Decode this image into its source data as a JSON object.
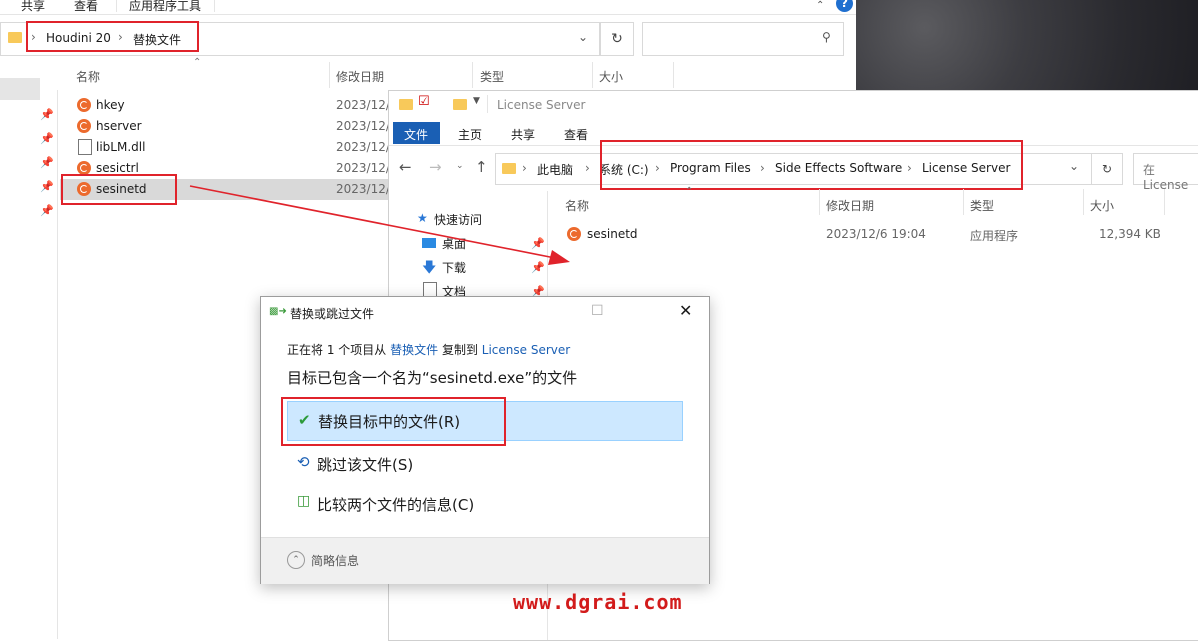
{
  "back_window": {
    "ribbon_tabs": [
      "共享",
      "查看",
      "应用程序工具"
    ],
    "breadcrumb": [
      "Houdini 20",
      "替换文件"
    ],
    "columns": [
      "名称",
      "修改日期",
      "类型",
      "大小"
    ],
    "files": [
      {
        "name": "hkey",
        "date": "2023/12/",
        "icon": "houdini-icon"
      },
      {
        "name": "hserver",
        "date": "2023/12/",
        "icon": "houdini-icon"
      },
      {
        "name": "libLM.dll",
        "date": "2023/12/",
        "icon": "dll-icon"
      },
      {
        "name": "sesictrl",
        "date": "2023/12/",
        "icon": "houdini-icon"
      },
      {
        "name": "sesinetd",
        "date": "2023/12/",
        "icon": "houdini-icon"
      }
    ]
  },
  "front_window": {
    "title": "License Server",
    "ribbon_tabs": [
      "文件",
      "主页",
      "共享",
      "查看"
    ],
    "breadcrumb": [
      "此电脑",
      "系统 (C:)",
      "Program Files",
      "Side Effects Software",
      "License Server"
    ],
    "search_placeholder": "在 License",
    "nav_items": [
      "快速访问",
      "桌面",
      "下载",
      "文档"
    ],
    "columns": [
      "名称",
      "修改日期",
      "类型",
      "大小"
    ],
    "files": [
      {
        "name": "sesinetd",
        "date": "2023/12/6 19:04",
        "type": "应用程序",
        "size": "12,394 KB"
      }
    ]
  },
  "dialog": {
    "title": "替换或跳过文件",
    "line1_prefix": "正在将 1 个项目从",
    "line1_source": "替换文件",
    "line1_middle": "复制到",
    "line1_dest": "License Server",
    "heading": "目标已包含一个名为“sesinetd.exe”的文件",
    "option_replace": "替换目标中的文件(R)",
    "option_skip": "跳过该文件(S)",
    "option_compare": "比较两个文件的信息(C)",
    "details": "简略信息"
  },
  "watermark": "www.dgrai.com",
  "colors": {
    "accent": "#1a5fb4",
    "highlight": "#e0232b",
    "selection": "#cde8ff"
  }
}
